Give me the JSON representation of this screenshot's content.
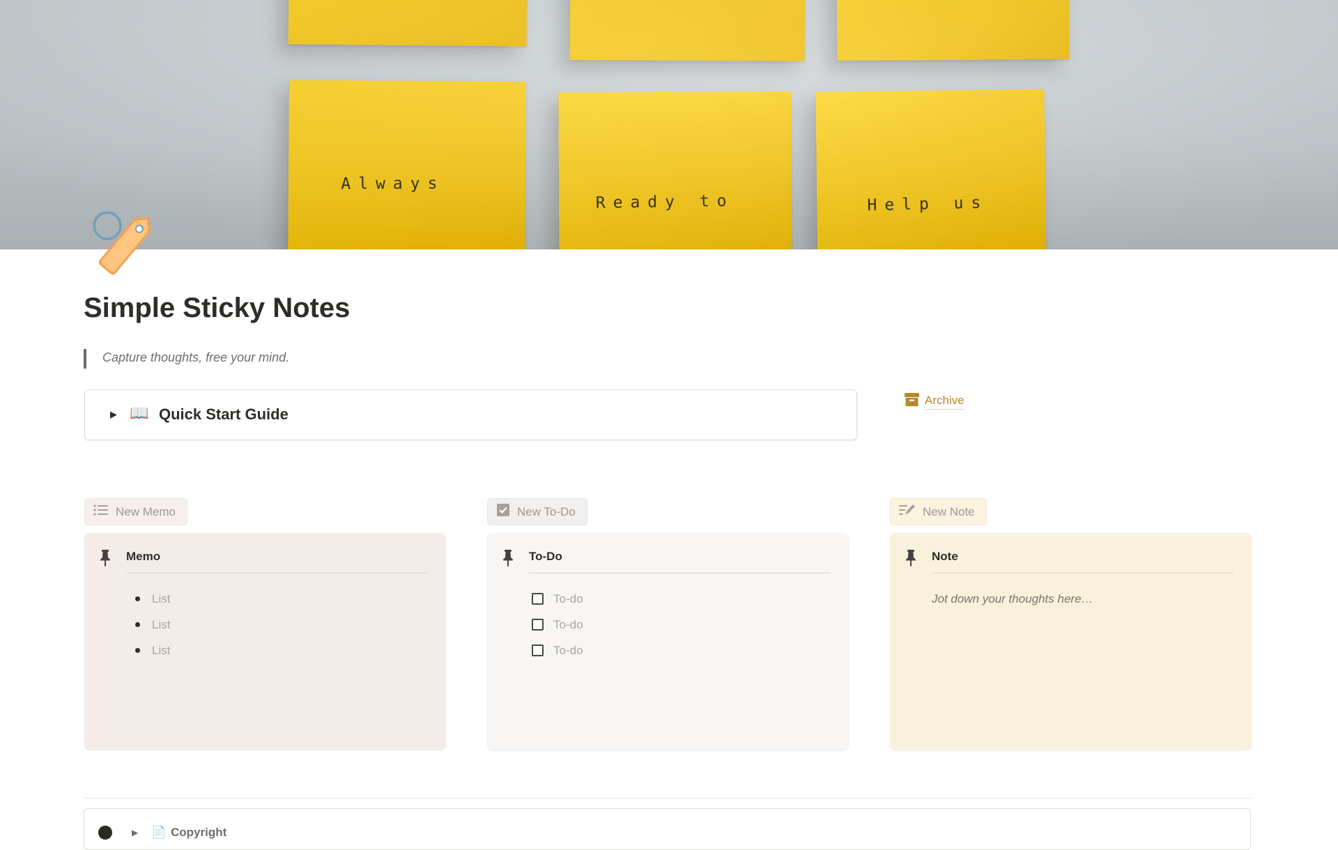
{
  "cover": {
    "notes": [
      "Always",
      "Ready to",
      "Help us"
    ]
  },
  "page": {
    "icon": "tag-icon",
    "title": "Simple Sticky Notes",
    "quote": "Capture thoughts, free your mind."
  },
  "toggle": {
    "emoji": "📖",
    "label": "Quick Start Guide"
  },
  "archive": {
    "icon": "archive-box-icon",
    "label": "Archive",
    "color": "#b8882d"
  },
  "buttons": {
    "memo": "New Memo",
    "todo": "New To-Do",
    "note": "New Note"
  },
  "memo": {
    "title": "Memo",
    "items": [
      "List",
      "List",
      "List"
    ],
    "background": "#f4ece9"
  },
  "todo": {
    "title": "To-Do",
    "items": [
      "To-do",
      "To-do",
      "To-do"
    ],
    "background": "#f7f6f4"
  },
  "note": {
    "title": "Note",
    "placeholder": "Jot down your thoughts here…",
    "background": "#f9f1db"
  },
  "copyright": {
    "icon": "📄",
    "label": "Copyright"
  }
}
